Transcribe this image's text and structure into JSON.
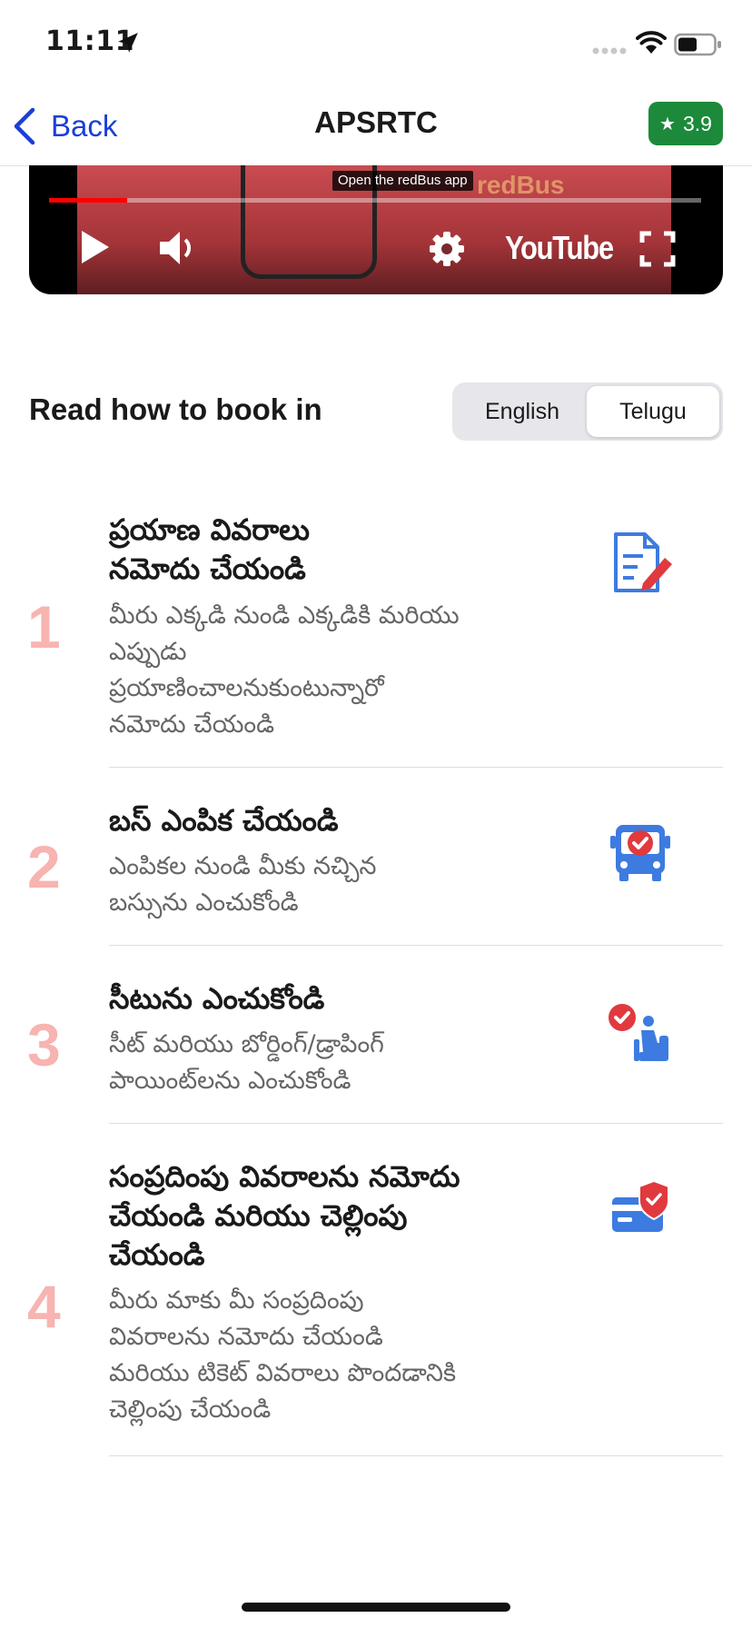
{
  "status_bar": {
    "time": "11:11"
  },
  "nav": {
    "back_label": "Back",
    "title": "APSRTC",
    "rating": "3.9"
  },
  "video": {
    "tooltip": "Open the redBus app",
    "logo_text": "redBus",
    "youtube_label": "YouTube",
    "progress_fraction": 0.12
  },
  "language": {
    "heading": "Read how to book in",
    "options": [
      "English",
      "Telugu"
    ],
    "selected": "Telugu"
  },
  "steps": [
    {
      "number": "1",
      "title": "ప్రయాణ వివరాలు\nనమోదు చేయండి",
      "description": "మీరు ఎక్కడి నుండి ఎక్కడికి మరియు\nఎప్పుడు\nప్రయాణించాలనుకుంటున్నారో\nనమోదు చేయండి",
      "icon": "edit-document-icon"
    },
    {
      "number": "2",
      "title": "బస్ ఎంపిక చేయండి",
      "description": "ఎంపికల నుండి మీకు నచ్చిన\nబస్సును ఎంచుకోండి",
      "icon": "bus-check-icon"
    },
    {
      "number": "3",
      "title": "సీటును ఎంచుకోండి",
      "description": "సీట్ మరియు బోర్డింగ్/డ్రాపింగ్\nపాయింట్‌లను ఎంచుకోండి",
      "icon": "seat-check-icon"
    },
    {
      "number": "4",
      "title": "సంప్రదింపు వివరాలను నమోదు\nచేయండి మరియు చెల్లింపు\nచేయండి",
      "description": "మీరు మాకు మీ సంప్రదింపు\nవివరాలను నమోదు చేయండి\nమరియు టికెట్ వివరాలు పొందడానికి\nచెల్లింపు చేయండి",
      "icon": "secure-card-icon"
    }
  ],
  "colors": {
    "accent_blue": "#1a3fd6",
    "rating_green": "#1c8a3a",
    "step_number": "#f7b4b0",
    "icon_blue": "#3d7be0",
    "icon_red": "#e03a3e"
  }
}
